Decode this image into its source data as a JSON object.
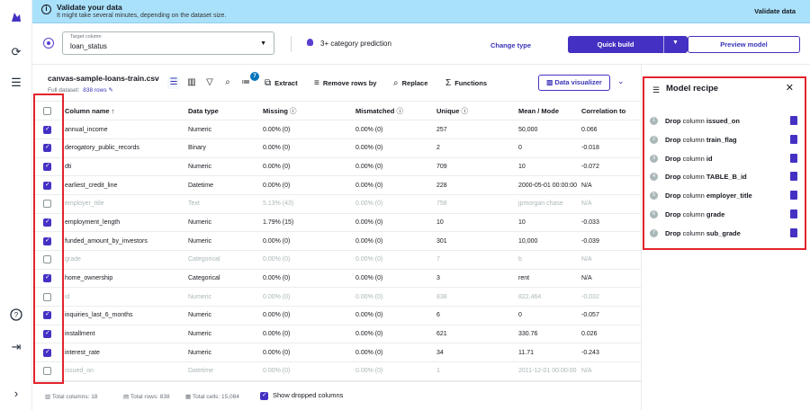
{
  "banner": {
    "title": "Validate your data",
    "subtitle": "It might take several minutes, depending on the dataset size.",
    "action": "Validate data"
  },
  "target": {
    "label": "Target column",
    "value": "loan_status",
    "prediction": "3+ category prediction",
    "change_type": "Change type",
    "quick_build": "Quick build",
    "preview_model": "Preview model"
  },
  "toolbar": {
    "file_name": "canvas-sample-loans-train.csv",
    "full_dataset": "Full dataset:",
    "rows": "838 rows",
    "badge": "7",
    "extract": "Extract",
    "remove_rows": "Remove rows by",
    "replace": "Replace",
    "functions": "Functions",
    "data_visualizer": "Data visualizer"
  },
  "grid": {
    "headers": [
      "Column name",
      "Data type",
      "Missing",
      "Mismatched",
      "Unique",
      "Mean / Mode",
      "Correlation to"
    ],
    "rows": [
      {
        "checked": true,
        "name": "annual_income",
        "type": "Numeric",
        "missing": "0.00% (0)",
        "mismatched": "0.00% (0)",
        "unique": "257",
        "mean": "50,000",
        "corr": "0.066"
      },
      {
        "checked": true,
        "name": "derogatory_public_records",
        "type": "Binary",
        "missing": "0.00% (0)",
        "mismatched": "0.00% (0)",
        "unique": "2",
        "mean": "0",
        "corr": "-0.018"
      },
      {
        "checked": true,
        "name": "dti",
        "type": "Numeric",
        "missing": "0.00% (0)",
        "mismatched": "0.00% (0)",
        "unique": "709",
        "mean": "10",
        "corr": "-0.072"
      },
      {
        "checked": true,
        "name": "earliest_credit_line",
        "type": "Datetime",
        "missing": "0.00% (0)",
        "mismatched": "0.00% (0)",
        "unique": "228",
        "mean": "2000-05-01 00:00:00",
        "corr": "N/A"
      },
      {
        "checked": false,
        "name": "employer_title",
        "type": "Text",
        "missing": "5.13% (43)",
        "mismatched": "0.00% (0)",
        "unique": "758",
        "mean": "jpmorgan chase",
        "corr": "N/A"
      },
      {
        "checked": true,
        "name": "employment_length",
        "type": "Numeric",
        "missing": "1.79% (15)",
        "mismatched": "0.00% (0)",
        "unique": "10",
        "mean": "10",
        "corr": "-0.033"
      },
      {
        "checked": true,
        "name": "funded_amount_by_investors",
        "type": "Numeric",
        "missing": "0.00% (0)",
        "mismatched": "0.00% (0)",
        "unique": "301",
        "mean": "10,000",
        "corr": "-0.039"
      },
      {
        "checked": false,
        "name": "grade",
        "type": "Categorical",
        "missing": "0.00% (0)",
        "mismatched": "0.00% (0)",
        "unique": "7",
        "mean": "b",
        "corr": "N/A"
      },
      {
        "checked": true,
        "name": "home_ownership",
        "type": "Categorical",
        "missing": "0.00% (0)",
        "mismatched": "0.00% (0)",
        "unique": "3",
        "mean": "rent",
        "corr": "N/A"
      },
      {
        "checked": false,
        "name": "id",
        "type": "Numeric",
        "missing": "0.00% (0)",
        "mismatched": "0.00% (0)",
        "unique": "838",
        "mean": "822,464",
        "corr": "-0.032"
      },
      {
        "checked": true,
        "name": "inquiries_last_6_months",
        "type": "Numeric",
        "missing": "0.00% (0)",
        "mismatched": "0.00% (0)",
        "unique": "6",
        "mean": "0",
        "corr": "-0.057"
      },
      {
        "checked": true,
        "name": "installment",
        "type": "Numeric",
        "missing": "0.00% (0)",
        "mismatched": "0.00% (0)",
        "unique": "621",
        "mean": "330.76",
        "corr": "0.026"
      },
      {
        "checked": true,
        "name": "interest_rate",
        "type": "Numeric",
        "missing": "0.00% (0)",
        "mismatched": "0.00% (0)",
        "unique": "34",
        "mean": "11.71",
        "corr": "-0.243"
      },
      {
        "checked": false,
        "name": "issued_on",
        "type": "Datetime",
        "missing": "0.00% (0)",
        "mismatched": "0.00% (0)",
        "unique": "1",
        "mean": "2011-12-01 00:00:00",
        "corr": "N/A"
      }
    ]
  },
  "footer": {
    "columns": "Total columns: 18",
    "rows": "Total rows: 838",
    "cells": "Total cells: 15,084",
    "show_dropped": "Show dropped columns"
  },
  "recipe": {
    "title": "Model recipe",
    "steps": [
      {
        "n": "1",
        "action": "Drop",
        "word": "column",
        "col": "issued_on"
      },
      {
        "n": "2",
        "action": "Drop",
        "word": "column",
        "col": "train_flag"
      },
      {
        "n": "3",
        "action": "Drop",
        "word": "column",
        "col": "id"
      },
      {
        "n": "4",
        "action": "Drop",
        "word": "column",
        "col": "TABLE_B_id"
      },
      {
        "n": "5",
        "action": "Drop",
        "word": "column",
        "col": "employer_title"
      },
      {
        "n": "6",
        "action": "Drop",
        "word": "column",
        "col": "grade"
      },
      {
        "n": "7",
        "action": "Drop",
        "word": "column",
        "col": "sub_grade"
      }
    ]
  },
  "colors": {
    "accent": "#4431c3",
    "banner": "#aae1fa",
    "highlight": "#e3232b"
  }
}
